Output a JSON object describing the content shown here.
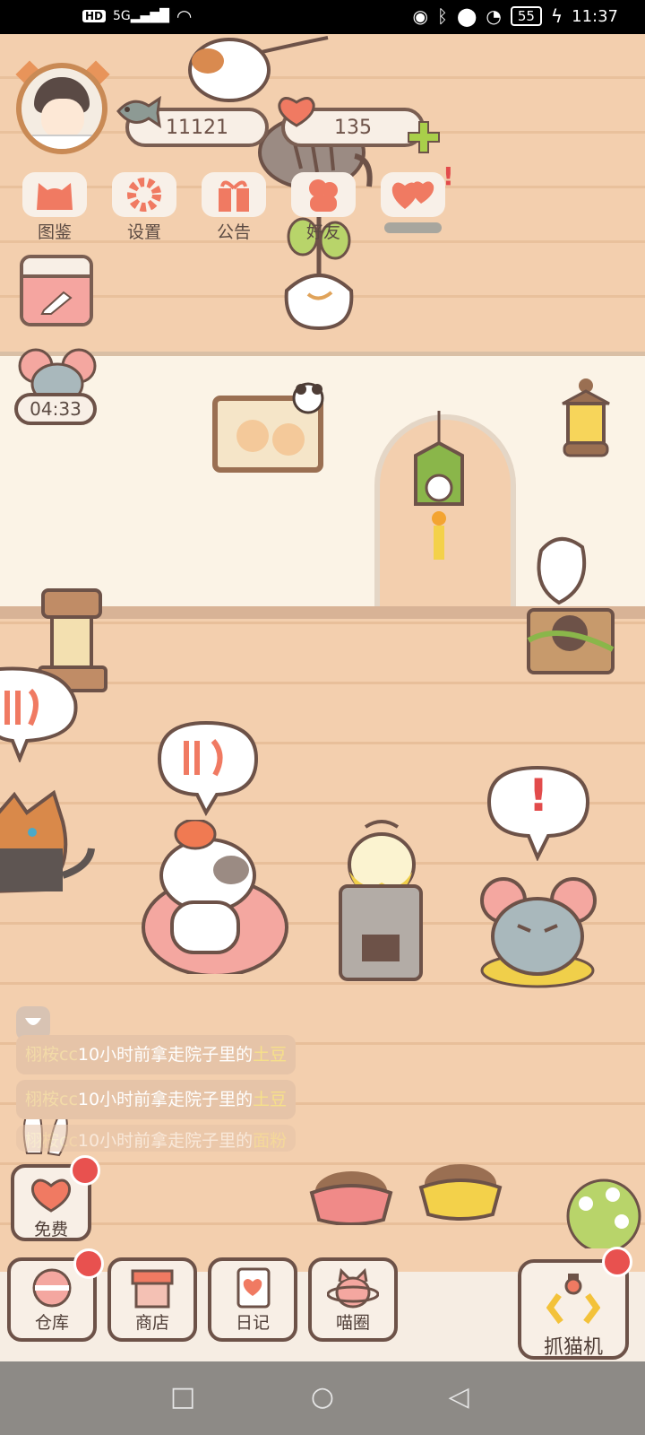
{
  "status_bar": {
    "hd": "HD",
    "signal": "5G",
    "battery": "55",
    "time": "11:37"
  },
  "player": {
    "fish_count": "11121",
    "heart_count": "135"
  },
  "top_menu": [
    {
      "id": "atlas",
      "label": "图鉴"
    },
    {
      "id": "settings",
      "label": "设置"
    },
    {
      "id": "notice",
      "label": "公告"
    },
    {
      "id": "friends",
      "label": "好友"
    },
    {
      "id": "hearts",
      "label": "",
      "alert": "!"
    }
  ],
  "timer": {
    "value": "04:33"
  },
  "speech": {
    "exclaim": "!"
  },
  "chat_feed": [
    {
      "who": "栩桉cc",
      "text": "10小时前拿走院子里的",
      "item": "土豆"
    },
    {
      "who": "栩桉cc",
      "text": "10小时前拿走院子里的",
      "item": "土豆"
    },
    {
      "who": "栩桉cc",
      "text": "10小时前拿走院子里的",
      "item": "面粉"
    }
  ],
  "bottom_menu": {
    "free": "免费",
    "warehouse": "仓库",
    "shop": "商店",
    "diary": "日记",
    "circle": "喵圈",
    "claw": "抓猫机"
  },
  "colors": {
    "accent": "#f07a62",
    "outline": "#6d5248",
    "badge": "#e8514f"
  }
}
